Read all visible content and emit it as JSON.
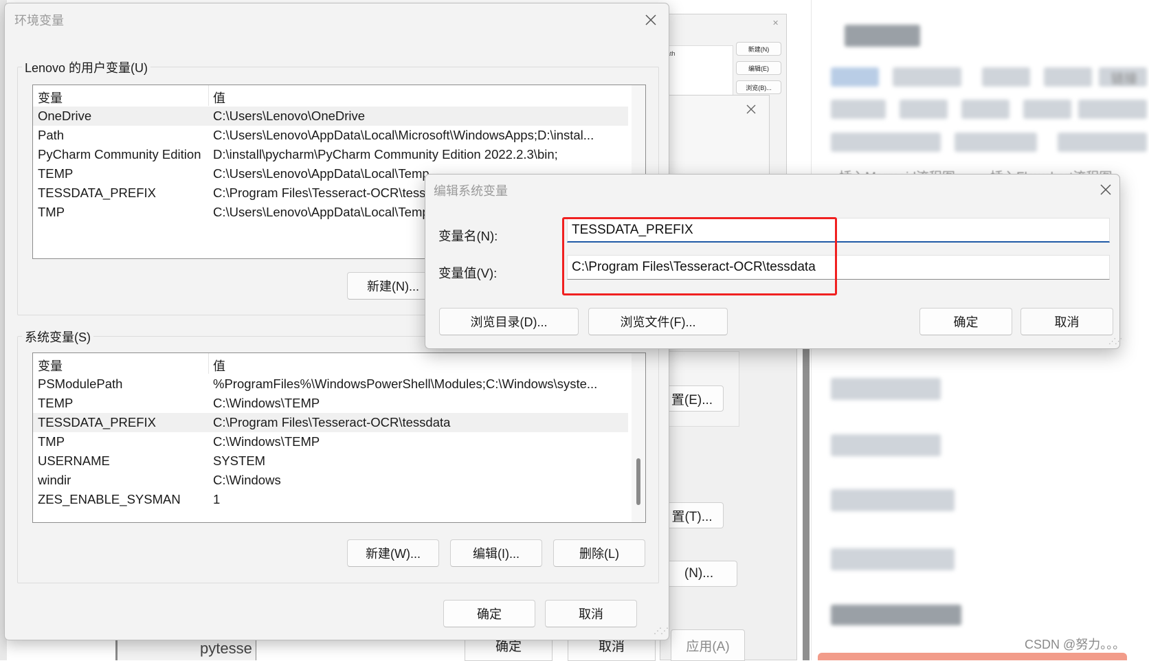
{
  "env_dialog": {
    "title": "环境变量",
    "user_group_label": "Lenovo 的用户变量(U)",
    "system_group_label": "系统变量(S)",
    "col_name": "变量",
    "col_value": "值",
    "user_vars": [
      {
        "name": "OneDrive",
        "value": "C:\\Users\\Lenovo\\OneDrive"
      },
      {
        "name": "Path",
        "value": "C:\\Users\\Lenovo\\AppData\\Local\\Microsoft\\WindowsApps;D:\\instal..."
      },
      {
        "name": "PyCharm Community Edition",
        "value": "D:\\install\\pycharm\\PyCharm Community Edition 2022.2.3\\bin;"
      },
      {
        "name": "TEMP",
        "value": "C:\\Users\\Lenovo\\AppData\\Local\\Temp"
      },
      {
        "name": "TESSDATA_PREFIX",
        "value": "C:\\Program Files\\Tesseract-OCR\\tessdata"
      },
      {
        "name": "TMP",
        "value": "C:\\Users\\Lenovo\\AppData\\Local\\Temp"
      }
    ],
    "system_vars": [
      {
        "name": "PSModulePath",
        "value": "%ProgramFiles%\\WindowsPowerShell\\Modules;C:\\Windows\\syste..."
      },
      {
        "name": "TEMP",
        "value": "C:\\Windows\\TEMP"
      },
      {
        "name": "TESSDATA_PREFIX",
        "value": "C:\\Program Files\\Tesseract-OCR\\tessdata"
      },
      {
        "name": "TMP",
        "value": "C:\\Windows\\TEMP"
      },
      {
        "name": "USERNAME",
        "value": "SYSTEM"
      },
      {
        "name": "windir",
        "value": "C:\\Windows"
      },
      {
        "name": "ZES_ENABLE_SYSMAN",
        "value": "1"
      }
    ],
    "user_new_button": "新建(N)...",
    "system_new_button": "新建(W)...",
    "system_edit_button": "编辑(I)...",
    "system_delete_button": "删除(L)",
    "ok_button": "确定",
    "cancel_button": "取消"
  },
  "edit_dialog": {
    "title": "编辑系统变量",
    "name_label": "变量名(N):",
    "value_label": "变量值(V):",
    "name_value": "TESSDATA_PREFIX",
    "value_value": "C:\\Program Files\\Tesseract-OCR\\tessdata",
    "browse_dir_button": "浏览目录(D)...",
    "browse_file_button": "浏览文件(F)...",
    "ok_button": "确定",
    "cancel_button": "取消"
  },
  "background": {
    "mini_new_button": "新建(N)",
    "mini_edit_button": "编辑(E)",
    "mini_browse_button": "浏览(B)...",
    "mini_path_text": "ath",
    "props_button_env": "置(E)...",
    "props_button_t": "置(T)...",
    "props_button_n": "(N)...",
    "props_ok_button": "确定",
    "props_cancel_button": "取消",
    "props_apply_button": "应用(A)",
    "taskbar_text": "pytesse",
    "right_link_text": "链接",
    "right_partial_text_1": "插入Mermaid流程图",
    "right_partial_text_2": "插入Flowchart流程图",
    "watermark": "CSDN @努力。。。"
  },
  "colors": {
    "highlight_red": "#f02020",
    "focus_blue": "#1f5aa6",
    "dialog_bg": "#f3f3f3"
  }
}
